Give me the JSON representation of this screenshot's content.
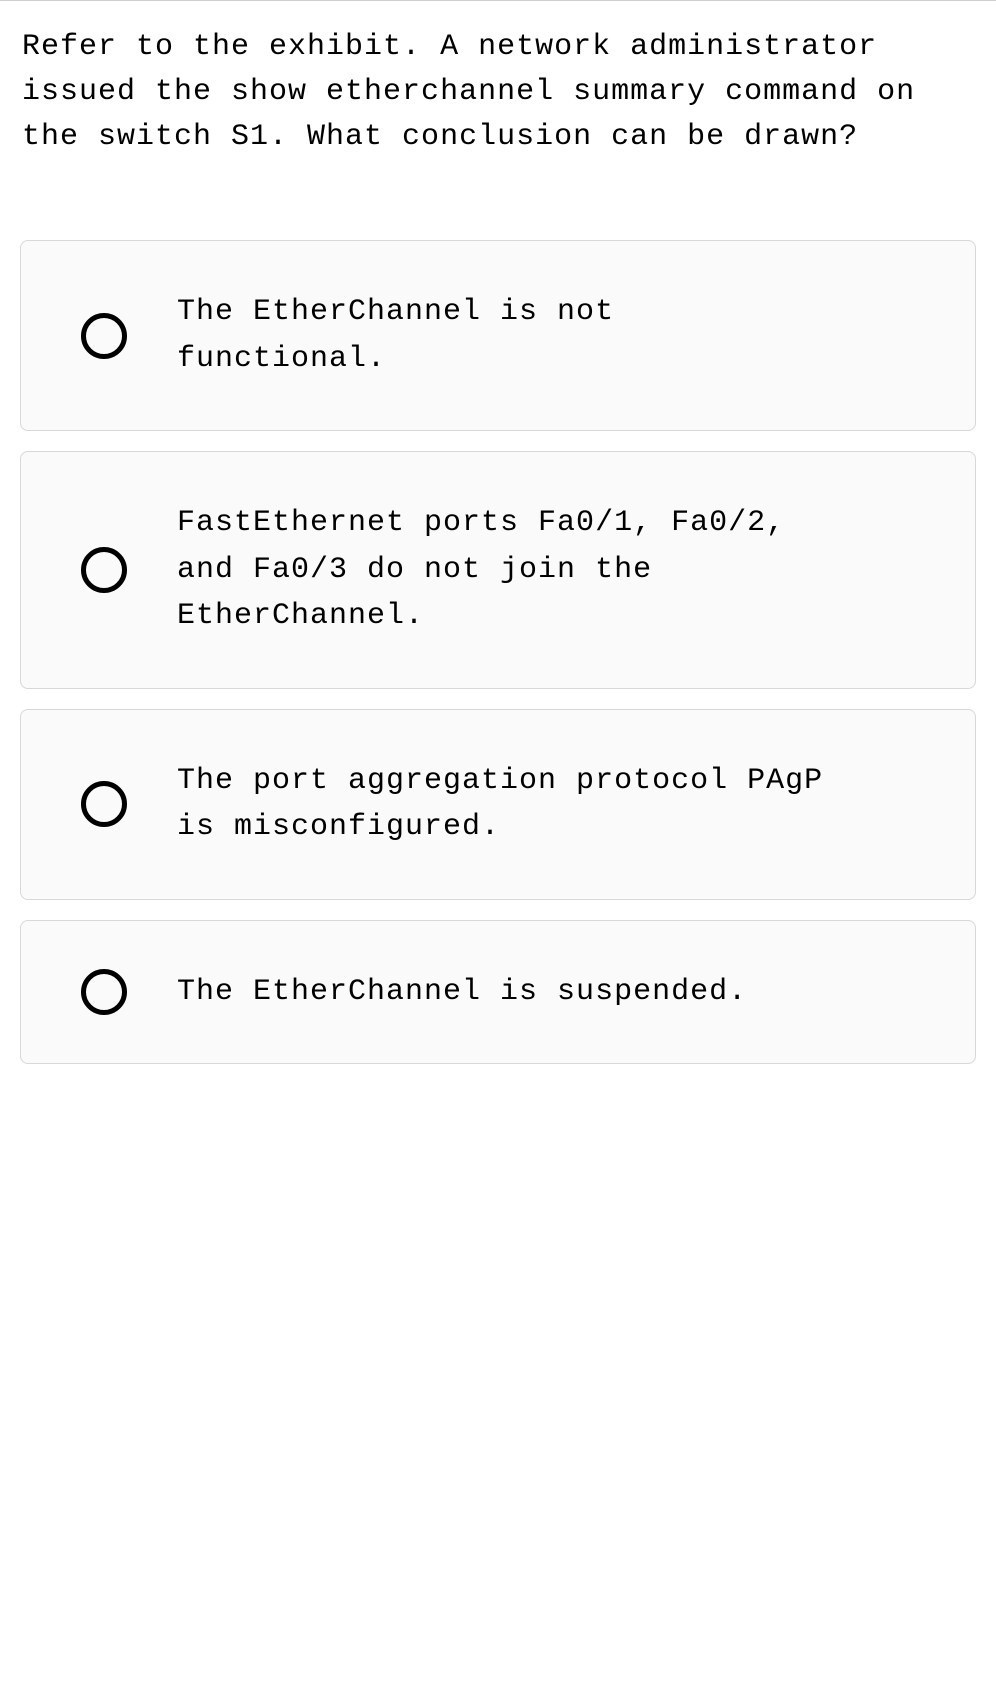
{
  "question": {
    "text": "Refer to the exhibit. A network administrator issued the show etherchannel summary command on the switch S1. What conclusion can be drawn?"
  },
  "options": [
    {
      "label": "The EtherChannel is not functional."
    },
    {
      "label": "FastEthernet ports Fa0/1, Fa0/2, and Fa0/3 do not join the EtherChannel."
    },
    {
      "label": "The port aggregation protocol PAgP is misconfigured."
    },
    {
      "label": "The EtherChannel is suspended."
    }
  ]
}
